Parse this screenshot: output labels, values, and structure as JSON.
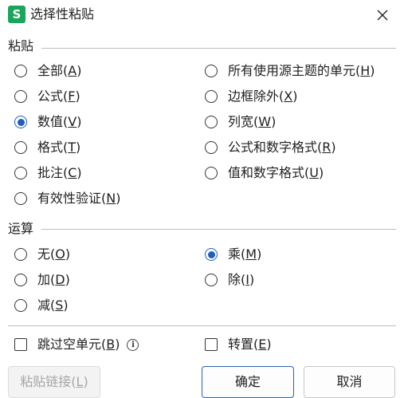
{
  "window": {
    "app_icon": "S",
    "title": "选择性粘贴",
    "close_icon": "close-icon"
  },
  "paste": {
    "section_label": "粘贴",
    "options": [
      {
        "label": "全部(A)",
        "mnemonic": "A",
        "checked": false
      },
      {
        "label": "公式(F)",
        "mnemonic": "F",
        "checked": false
      },
      {
        "label": "数值(V)",
        "mnemonic": "V",
        "checked": true
      },
      {
        "label": "格式(T)",
        "mnemonic": "T",
        "checked": false
      },
      {
        "label": "批注(C)",
        "mnemonic": "C",
        "checked": false
      },
      {
        "label": "有效性验证(N)",
        "mnemonic": "N",
        "checked": false
      },
      {
        "label": "所有使用源主题的单元(H)",
        "mnemonic": "H",
        "checked": false
      },
      {
        "label": "边框除外(X)",
        "mnemonic": "X",
        "checked": false
      },
      {
        "label": "列宽(W)",
        "mnemonic": "W",
        "checked": false
      },
      {
        "label": "公式和数字格式(R)",
        "mnemonic": "R",
        "checked": false
      },
      {
        "label": "值和数字格式(U)",
        "mnemonic": "U",
        "checked": false
      }
    ]
  },
  "operation": {
    "section_label": "运算",
    "options": [
      {
        "label": "无(O)",
        "mnemonic": "O",
        "checked": false
      },
      {
        "label": "加(D)",
        "mnemonic": "D",
        "checked": false
      },
      {
        "label": "减(S)",
        "mnemonic": "S",
        "checked": false
      },
      {
        "label": "乘(M)",
        "mnemonic": "M",
        "checked": true
      },
      {
        "label": "除(I)",
        "mnemonic": "I",
        "checked": false
      }
    ]
  },
  "checkboxes": {
    "skip_blanks": {
      "label": "跳过空单元(B)",
      "mnemonic": "B",
      "checked": false,
      "info_icon": "info-icon"
    },
    "transpose": {
      "label": "转置(E)",
      "mnemonic": "E",
      "checked": false
    }
  },
  "buttons": {
    "paste_link": {
      "label": "粘贴链接(L)",
      "mnemonic": "L",
      "enabled": false
    },
    "ok": {
      "label": "确定"
    },
    "cancel": {
      "label": "取消"
    }
  },
  "colors": {
    "accent": "#1e5fbf",
    "app_icon_bg": "#1aa55a",
    "disabled_text": "#a6a6a6"
  }
}
